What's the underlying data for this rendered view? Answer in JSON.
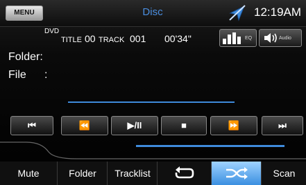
{
  "header": {
    "menu_label": "MENU",
    "source_label": "Disc",
    "clock": "12:19AM"
  },
  "info": {
    "media_type": "DVD",
    "title_label": "TITLE",
    "title_value": "00",
    "track_label": "TRACK",
    "track_value": "001",
    "elapsed": "00'34\""
  },
  "buttons": {
    "eq_label": "EQ",
    "audio_label": "Audio"
  },
  "fields": {
    "folder_label": "Folder:",
    "file_label": "File",
    "file_colon": ":"
  },
  "transport": {
    "prev": "⏮",
    "rewind": "⏪",
    "play_pause": "▶/II",
    "stop": "■",
    "forward": "⏩",
    "next": "⏭"
  },
  "bottom": {
    "mute": "Mute",
    "folder": "Folder",
    "tracklist": "Tracklist",
    "scan": "Scan"
  },
  "colors": {
    "accent": "#3f8bdc",
    "source": "#4a8ee0",
    "active_button": "#7cc0ff"
  }
}
